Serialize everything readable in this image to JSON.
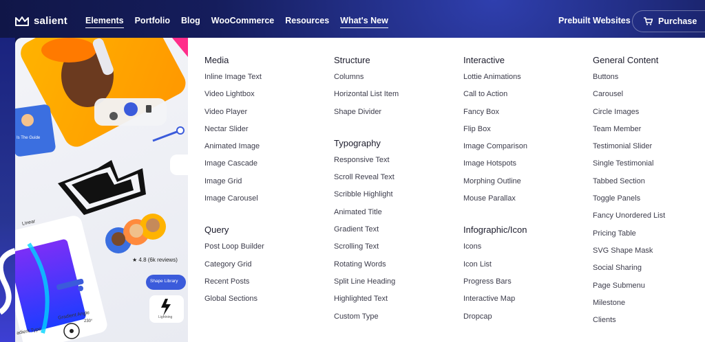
{
  "brand": {
    "name": "salient",
    "color": "#ffffff"
  },
  "nav": {
    "items": [
      {
        "label": "Elements",
        "underlined": true
      },
      {
        "label": "Portfolio",
        "underlined": false
      },
      {
        "label": "Blog",
        "underlined": false
      },
      {
        "label": "WooCommerce",
        "underlined": false
      },
      {
        "label": "Resources",
        "underlined": false
      },
      {
        "label": "What's New",
        "underlined": true
      }
    ],
    "prebuilt_label": "Prebuilt Websites",
    "purchase_label": "Purchase",
    "purchase_icon": "cart-icon"
  },
  "art": {
    "slider_label": "Linear",
    "gradient_type_label": "adient Type",
    "gradient_angle_label": "Gradient Angle",
    "angle_value": "230°",
    "rating_value": "4.8 (6k reviews)",
    "shape_library_label": "Shape Library",
    "lightning_label": "Lightning",
    "card_text": "Is The Guide"
  },
  "menu": {
    "columns": [
      {
        "groups": [
          {
            "title": "Media",
            "links": [
              "Inline Image Text",
              "Video Lightbox",
              "Video Player",
              "Nectar Slider",
              "Animated Image",
              "Image Cascade",
              "Image Grid",
              "Image Carousel"
            ]
          },
          {
            "title": "Query",
            "links": [
              "Post Loop Builder",
              "Category Grid",
              "Recent Posts",
              "Global Sections"
            ]
          }
        ]
      },
      {
        "groups": [
          {
            "title": "Structure",
            "links": [
              "Columns",
              "Horizontal List Item",
              "Shape Divider"
            ]
          },
          {
            "title": "Typography",
            "links": [
              "Responsive Text",
              "Scroll Reveal Text",
              "Scribble Highlight",
              "Animated Title",
              "Gradient Text",
              "Scrolling Text",
              "Rotating Words",
              "Split Line Heading",
              "Highlighted Text",
              "Custom Type"
            ]
          }
        ]
      },
      {
        "groups": [
          {
            "title": "Interactive",
            "links": [
              "Lottie Animations",
              "Call to Action",
              "Fancy Box",
              "Flip Box",
              "Image Comparison",
              "Image Hotspots",
              "Morphing Outline",
              "Mouse Parallax"
            ]
          },
          {
            "title": "Infographic/Icon",
            "links": [
              "Icons",
              "Icon List",
              "Progress Bars",
              "Interactive Map",
              "Dropcap"
            ]
          }
        ]
      },
      {
        "groups": [
          {
            "title": "General Content",
            "links": [
              "Buttons",
              "Carousel",
              "Circle Images",
              "Team Member",
              "Testimonial Slider",
              "Single Testimonial",
              "Tabbed Section",
              "Toggle Panels",
              "Fancy Unordered List",
              "Pricing Table",
              "SVG Shape Mask",
              "Social Sharing",
              "Page Submenu",
              "Milestone",
              "Clients"
            ]
          }
        ]
      }
    ]
  },
  "colors": {
    "nav_bg": "#151d5c",
    "accent": "#3b5bdb",
    "text": "#3b3b4a"
  }
}
